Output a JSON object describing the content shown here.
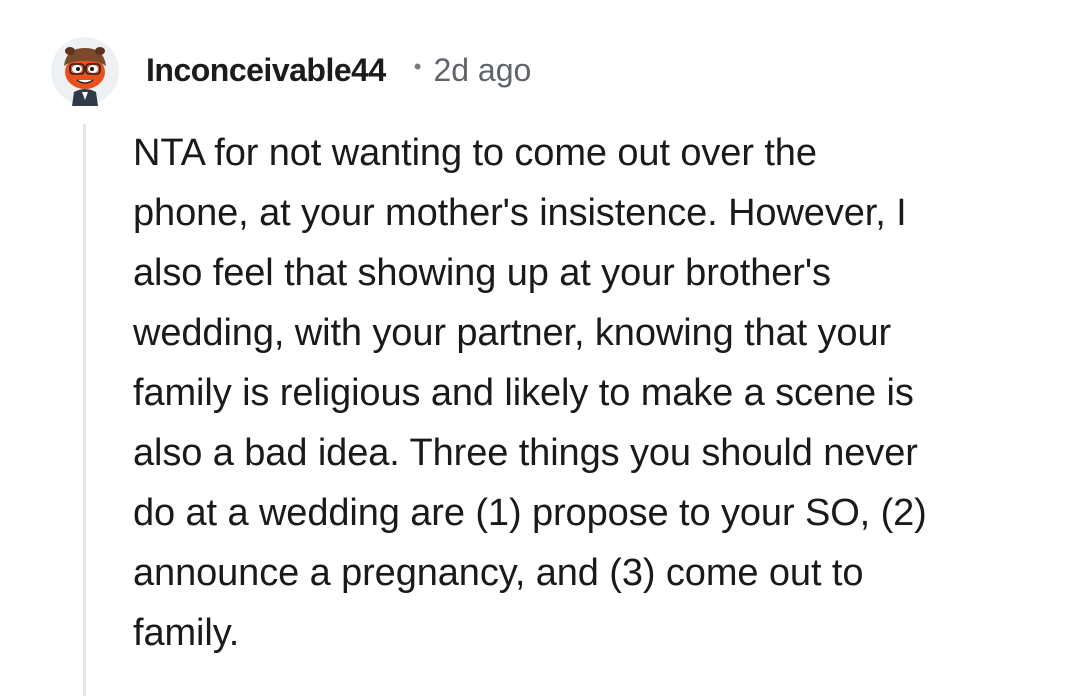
{
  "comment": {
    "author": {
      "username": "Inconceivable44",
      "avatar_icon": "snoo-avatar-icon"
    },
    "separator": "•",
    "timestamp": "2d ago",
    "body": "NTA for not wanting to come out over the\nphone, at your mother's insistence. However, I\nalso feel that showing up at your brother's\nwedding, with your partner, knowing that your\nfamily is religious and likely to make a scene is\nalso a bad idea. Three things you should never\ndo at a wedding are (1) propose to your SO, (2)\nannounce a pregnancy, and (3) come out to\nfamily."
  },
  "colors": {
    "text": "#1a1a1b",
    "meta": "#5f6469",
    "thread_line": "#e4e6e8",
    "avatar_orange": "#e8501e",
    "avatar_brown": "#7a4a2a"
  }
}
